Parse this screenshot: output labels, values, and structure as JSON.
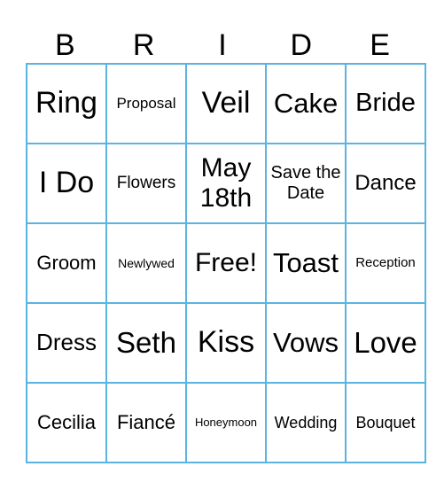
{
  "header": {
    "letters": [
      "B",
      "R",
      "I",
      "D",
      "E"
    ]
  },
  "accent_color": "#5ab4e2",
  "rows": [
    [
      {
        "text": "Ring",
        "size": 34
      },
      {
        "text": "Proposal",
        "size": 17
      },
      {
        "text": "Veil",
        "size": 34
      },
      {
        "text": "Cake",
        "size": 31
      },
      {
        "text": "Bride",
        "size": 29
      }
    ],
    [
      {
        "text": "I Do",
        "size": 34
      },
      {
        "text": "Flowers",
        "size": 19
      },
      {
        "text": "May 18th",
        "size": 30
      },
      {
        "text": "Save the Date",
        "size": 20
      },
      {
        "text": "Dance",
        "size": 24
      }
    ],
    [
      {
        "text": "Groom",
        "size": 22
      },
      {
        "text": "Newlywed",
        "size": 14
      },
      {
        "text": "Free!",
        "size": 30
      },
      {
        "text": "Toast",
        "size": 31
      },
      {
        "text": "Reception",
        "size": 15
      }
    ],
    [
      {
        "text": "Dress",
        "size": 26
      },
      {
        "text": "Seth",
        "size": 33
      },
      {
        "text": "Kiss",
        "size": 34
      },
      {
        "text": "Vows",
        "size": 31
      },
      {
        "text": "Love",
        "size": 33
      }
    ],
    [
      {
        "text": "Cecilia",
        "size": 22
      },
      {
        "text": "Fiancé",
        "size": 22
      },
      {
        "text": "Honeymoon",
        "size": 13
      },
      {
        "text": "Wedding",
        "size": 18
      },
      {
        "text": "Bouquet",
        "size": 18
      }
    ]
  ]
}
